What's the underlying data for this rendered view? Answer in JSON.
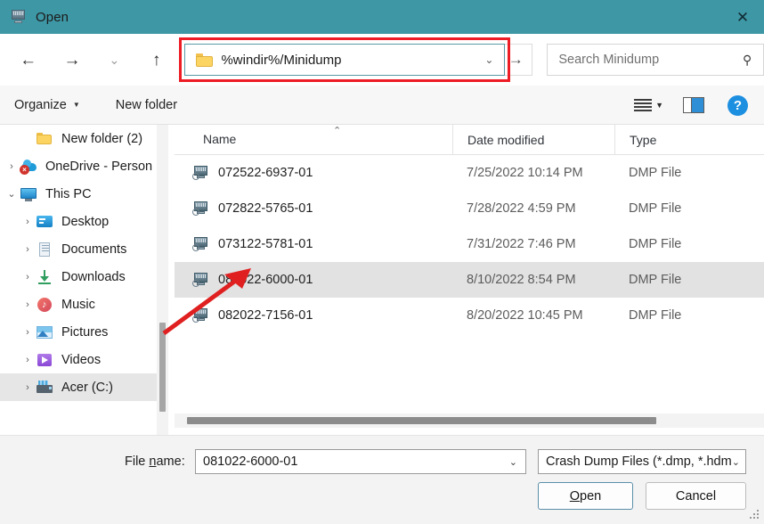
{
  "window": {
    "title": "Open",
    "icon": "crash-dump-window-icon",
    "close_label": "✕"
  },
  "nav": {
    "back": "←",
    "forward": "→",
    "recent": "⌄",
    "up": "↑",
    "go": "→",
    "address_value": "%windir%/Minidump",
    "address_chevron": "⌄",
    "highlight_color": "#ee1c25"
  },
  "search": {
    "placeholder": "Search Minidump",
    "icon": "search-icon"
  },
  "toolbar": {
    "organize_label": "Organize",
    "organize_caret": "▼",
    "new_folder_label": "New folder",
    "view_caret": "▼",
    "help_label": "?"
  },
  "sidebar": {
    "items": [
      {
        "label": "New folder (2)",
        "icon": "folder-icon",
        "expander": "",
        "indent": 1,
        "selected": false
      },
      {
        "label": "OneDrive - Person",
        "icon": "onedrive-icon",
        "expander": "›",
        "indent": 0,
        "selected": false
      },
      {
        "label": "This PC",
        "icon": "this-pc-icon",
        "expander": "⌄",
        "indent": 0,
        "selected": false
      },
      {
        "label": "Desktop",
        "icon": "desktop-icon",
        "expander": "›",
        "indent": 1,
        "selected": false
      },
      {
        "label": "Documents",
        "icon": "documents-icon",
        "expander": "›",
        "indent": 1,
        "selected": false
      },
      {
        "label": "Downloads",
        "icon": "downloads-icon",
        "expander": "›",
        "indent": 1,
        "selected": false
      },
      {
        "label": "Music",
        "icon": "music-icon",
        "expander": "›",
        "indent": 1,
        "selected": false
      },
      {
        "label": "Pictures",
        "icon": "pictures-icon",
        "expander": "›",
        "indent": 1,
        "selected": false
      },
      {
        "label": "Videos",
        "icon": "videos-icon",
        "expander": "›",
        "indent": 1,
        "selected": false
      },
      {
        "label": "Acer (C:)",
        "icon": "drive-icon",
        "expander": "›",
        "indent": 1,
        "selected": true
      }
    ]
  },
  "file_list": {
    "columns": [
      "Name",
      "Date modified",
      "Type"
    ],
    "sort_indicator": "⌃",
    "rows": [
      {
        "name": "072522-6937-01",
        "date": "7/25/2022 10:14 PM",
        "type": "DMP File",
        "selected": false
      },
      {
        "name": "072822-5765-01",
        "date": "7/28/2022 4:59 PM",
        "type": "DMP File",
        "selected": false
      },
      {
        "name": "073122-5781-01",
        "date": "7/31/2022 7:46 PM",
        "type": "DMP File",
        "selected": false
      },
      {
        "name": "081022-6000-01",
        "date": "8/10/2022 8:54 PM",
        "type": "DMP File",
        "selected": true
      },
      {
        "name": "082022-7156-01",
        "date": "8/20/2022 10:45 PM",
        "type": "DMP File",
        "selected": false
      }
    ]
  },
  "footer": {
    "file_name_label_pre": "File ",
    "file_name_label_accel": "n",
    "file_name_label_post": "ame:",
    "file_name_value": "081022-6000-01",
    "file_name_caret": "⌄",
    "file_type_value": "Crash Dump Files (*.dmp, *.hdm",
    "file_type_caret": "⌄",
    "open_accel": "O",
    "open_rest": "pen",
    "cancel_label": "Cancel"
  }
}
